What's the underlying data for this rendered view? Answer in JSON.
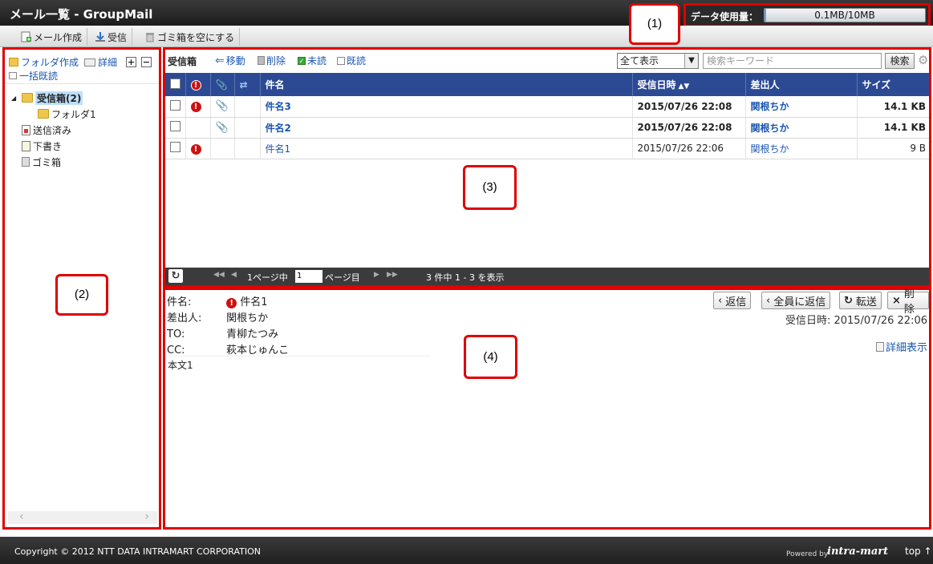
{
  "app": {
    "title": "メール一覧 - GroupMail",
    "usage_label": "データ使用量：",
    "usage_value": "0.1MB/10MB",
    "usage_fraction": 0.01
  },
  "toolbar": {
    "compose": "メール作成",
    "receive": "受信",
    "empty_trash": "ゴミ箱を空にする"
  },
  "annotations": [
    "(1)",
    "(2)",
    "(3)",
    "(4)"
  ],
  "sidebar": {
    "create_folder": "フォルダ作成",
    "details": "詳細",
    "mark_all_read": "一括既読",
    "folders": [
      {
        "label": "受信箱(2)"
      },
      {
        "label": "フォルダ1"
      },
      {
        "label": "送信済み"
      },
      {
        "label": "下書き"
      },
      {
        "label": "ゴミ箱"
      }
    ]
  },
  "list": {
    "folder_name": "受信箱",
    "move": "移動",
    "delete": "削除",
    "unread": "未読",
    "read": "既読",
    "filter_selected": "全て表示",
    "search_placeholder": "検索キーワード",
    "search_button": "検索",
    "columns": {
      "subject": "件名",
      "received": "受信日時",
      "sender": "差出人",
      "size": "サイズ"
    },
    "rows": [
      {
        "subject": "件名3",
        "received": "2015/07/26 22:08",
        "sender": "関根ちか",
        "size": "14.1 KB",
        "urgent": "!",
        "attach": "📎"
      },
      {
        "subject": "件名2",
        "received": "2015/07/26 22:08",
        "sender": "関根ちか",
        "size": "14.1 KB",
        "urgent": "",
        "attach": "📎"
      },
      {
        "subject": "件名1",
        "received": "2015/07/26 22:06",
        "sender": "関根ちか",
        "size": "9 B",
        "urgent": "!",
        "attach": ""
      }
    ],
    "pager": {
      "page_total": "1ページ中",
      "page_value": "1",
      "page_suffix": "ページ目",
      "summary": "3 件中 1 - 3 を表示"
    }
  },
  "preview": {
    "subject_label": "件名:",
    "subject": "件名1",
    "from_label": "差出人:",
    "from": "関根ちか",
    "to_label": "TO:",
    "to": "青柳たつみ",
    "cc_label": "CC:",
    "cc": "萩本じゅんこ",
    "body": "本文1",
    "reply": "返信",
    "reply_all": "全員に返信",
    "forward": "転送",
    "delete": "削除",
    "received": "受信日時: 2015/07/26 22:06",
    "details": "詳細表示"
  },
  "footer": {
    "copyright": "Copyright © 2012 NTT DATA INTRAMART CORPORATION",
    "powered_by": "Powered by",
    "brand": "intra-mart",
    "top": "top ↑"
  }
}
